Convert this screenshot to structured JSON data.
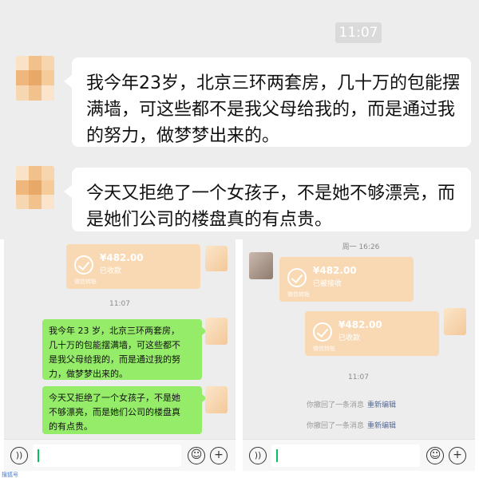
{
  "top": {
    "time": "11:07",
    "messages": [
      {
        "lines": [
          "我今年23岁，北京三环两套房，几十万的包能摆",
          "满墙，可这些都不是我父母给我的，而是通过我",
          "的努力，做梦梦出来的。"
        ]
      },
      {
        "lines": [
          "今天又拒绝了一个女孩子，不是她不够漂亮，而",
          "是她们公司的楼盘真的有点贵。"
        ]
      }
    ]
  },
  "left_panel": {
    "transfer": {
      "amount": "¥482.00",
      "status": "已收款",
      "foot": "微信转账"
    },
    "time": "11:07",
    "messages": [
      {
        "lines": [
          "我今年 23 岁，北京三环两套房，",
          "几十万的包能摆满墙，可这些都不",
          "是我父母给我的，而是通过我的努",
          "力，做梦梦出来的。"
        ]
      },
      {
        "lines": [
          "今天又拒绝了一个女孩子，不是她",
          "不够漂亮，而是她们公司的楼盘真",
          "的有点贵。"
        ]
      }
    ],
    "input": {
      "voice_icon": "voice-icon",
      "emoji_icon": "emoji-icon",
      "plus_icon": "plus-icon"
    }
  },
  "right_panel": {
    "top_time": "周一 16:26",
    "transfer_received": {
      "amount": "¥482.00",
      "status": "已被接收",
      "foot": "微信转账"
    },
    "transfer_sent": {
      "amount": "¥482.00",
      "status": "已收款",
      "foot": "微信转账"
    },
    "time": "11:07",
    "recalls": [
      {
        "text": "你撤回了一条消息",
        "edit": "重新编辑"
      },
      {
        "text": "你撤回了一条消息",
        "edit": "重新编辑"
      }
    ]
  },
  "footer": {
    "link": "搜狐号"
  },
  "colors": {
    "green_bubble": "#95ec69",
    "transfer": "#f9d9b4",
    "chat_bg": "#ededed",
    "link": "#576b95"
  }
}
